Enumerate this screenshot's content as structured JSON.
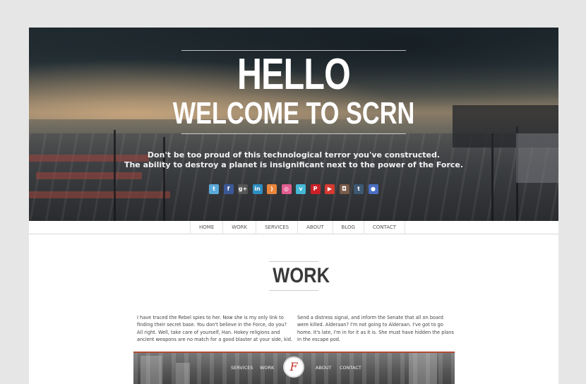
{
  "hero": {
    "title": "HELLO",
    "subtitle": "WELCOME TO SCRN",
    "tagline_line1": "Don't be too proud of this technological terror you've constructed.",
    "tagline_line2": "The ability to destroy a planet is insignificant next to the power of the Force."
  },
  "social": [
    {
      "name": "twitter-icon",
      "glyph": "t",
      "color": "#5aa9d9"
    },
    {
      "name": "facebook-icon",
      "glyph": "f",
      "color": "#3b5998"
    },
    {
      "name": "google-plus-icon",
      "glyph": "g+",
      "color": "#555555"
    },
    {
      "name": "linkedin-icon",
      "glyph": "in",
      "color": "#2d8ec2"
    },
    {
      "name": "rss-icon",
      "glyph": ")",
      "color": "#e8863c"
    },
    {
      "name": "dribbble-icon",
      "glyph": "◎",
      "color": "#e35d91"
    },
    {
      "name": "vimeo-icon",
      "glyph": "v",
      "color": "#44b8d6"
    },
    {
      "name": "pinterest-icon",
      "glyph": "P",
      "color": "#cb2027"
    },
    {
      "name": "youtube-icon",
      "glyph": "▶",
      "color": "#d63a30"
    },
    {
      "name": "instagram-icon",
      "glyph": "◘",
      "color": "#7a5a48"
    },
    {
      "name": "tumblr-icon",
      "glyph": "t",
      "color": "#3d5872"
    },
    {
      "name": "flickr-icon",
      "glyph": "●",
      "color": "#4a6fc2"
    }
  ],
  "nav": {
    "items": [
      "HOME",
      "WORK",
      "SERVICES",
      "ABOUT",
      "BLOG",
      "CONTACT"
    ]
  },
  "work": {
    "title": "WORK",
    "col1": "I have traced the Rebel spies to her. Now she is my only link to finding their secret base. You don't believe in the Force, do you? All right. Well, take care of yourself, Han. Hokey religions and ancient weapons are no match for a good blaster at your side, kid.",
    "col2": "Send a distress signal, and inform the Senate that all on board were killed. Alderaan? I'm not going to Alderaan. I've got to go home. It's late, I'm in for it as it is. She must have hidden the plans in the escape pod."
  },
  "preview": {
    "nav_left": [
      "SERVICES",
      "WORK"
    ],
    "nav_right": [
      "ABOUT",
      "CONTACT"
    ],
    "logo_letter": "F"
  }
}
